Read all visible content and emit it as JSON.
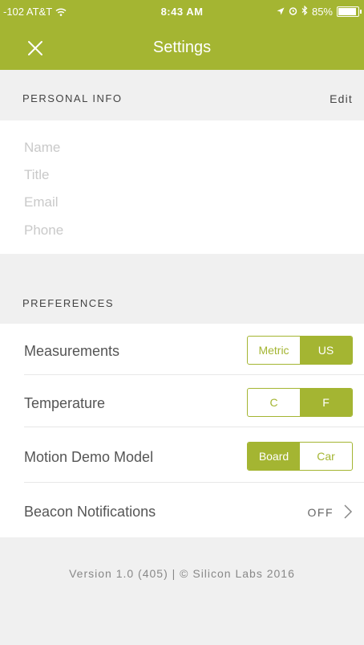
{
  "status_bar": {
    "carrier": "-102 AT&T",
    "time": "8:43 AM",
    "battery": "85%"
  },
  "header": {
    "title": "Settings",
    "close_icon": "close-icon"
  },
  "personal_info": {
    "section_label": "PERSONAL INFO",
    "edit_label": "Edit",
    "fields": [
      "Name",
      "Title",
      "Email",
      "Phone"
    ]
  },
  "preferences": {
    "section_label": "PREFERENCES",
    "measurements": {
      "label": "Measurements",
      "options": [
        "Metric",
        "US"
      ],
      "selected": "US"
    },
    "temperature": {
      "label": "Temperature",
      "options": [
        "C",
        "F"
      ],
      "selected": "F"
    },
    "motion_demo_model": {
      "label": "Motion Demo Model",
      "options": [
        "Board",
        "Car"
      ],
      "selected": "Board"
    },
    "beacon_notifications": {
      "label": "Beacon Notifications",
      "value": "OFF"
    }
  },
  "footer": {
    "version_text": "Version  1.0 (405) | © Silicon Labs 2016"
  },
  "colors": {
    "accent": "#a4b532",
    "background": "#f0f0f0"
  }
}
